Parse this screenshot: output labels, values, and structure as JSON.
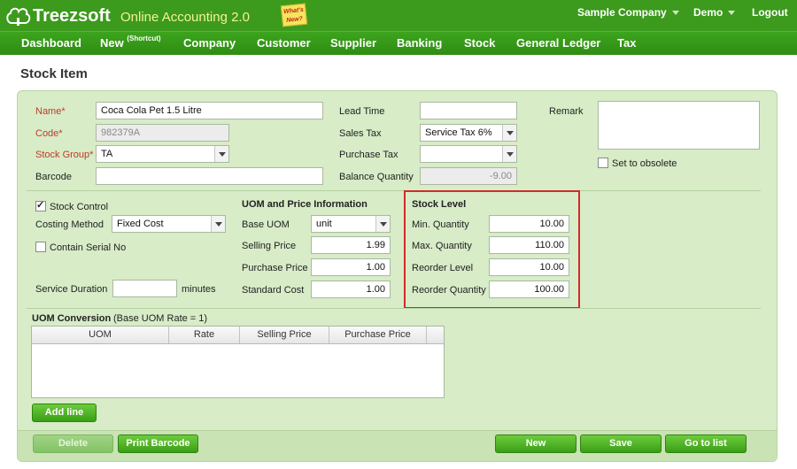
{
  "header": {
    "logo_text": "Treezsoft",
    "logo_sub": "Online Accounting 2.0",
    "whats_new": "What's New?",
    "company": "Sample Company",
    "user": "Demo",
    "logout": "Logout"
  },
  "nav": {
    "dashboard": "Dashboard",
    "new": "New",
    "new_sup": "(Shortcut)",
    "company": "Company",
    "customer": "Customer",
    "supplier": "Supplier",
    "banking": "Banking",
    "stock": "Stock",
    "general_ledger": "General Ledger",
    "tax": "Tax"
  },
  "page": {
    "title": "Stock Item"
  },
  "general": {
    "name_label": "Name*",
    "name_value": "Coca Cola Pet 1.5 Litre",
    "code_label": "Code*",
    "code_value": "982379A",
    "stock_group_label": "Stock Group*",
    "stock_group_value": "TA",
    "barcode_label": "Barcode",
    "barcode_value": "",
    "lead_time_label": "Lead Time",
    "lead_time_value": "",
    "sales_tax_label": "Sales Tax",
    "sales_tax_value": "Service Tax 6%",
    "purchase_tax_label": "Purchase Tax",
    "purchase_tax_value": "",
    "balance_qty_label": "Balance Quantity",
    "balance_qty_value": "-9.00",
    "remark_label": "Remark",
    "remark_value": "",
    "obsolete_label": "Set to obsolete",
    "obsolete_checked": false
  },
  "stock_control": {
    "stock_control_label": "Stock Control",
    "stock_control_checked": true,
    "costing_method_label": "Costing Method",
    "costing_method_value": "Fixed Cost",
    "serial_label": "Contain Serial No",
    "serial_checked": false,
    "service_duration_label": "Service Duration",
    "service_duration_value": "",
    "minutes_label": "minutes"
  },
  "uom_price": {
    "heading": "UOM and Price Information",
    "base_uom_label": "Base UOM",
    "base_uom_value": "unit",
    "selling_price_label": "Selling Price",
    "selling_price_value": "1.99",
    "purchase_price_label": "Purchase Price",
    "purchase_price_value": "1.00",
    "standard_cost_label": "Standard Cost",
    "standard_cost_value": "1.00"
  },
  "stock_level": {
    "heading": "Stock Level",
    "min_label": "Min. Quantity",
    "min_value": "10.00",
    "max_label": "Max. Quantity",
    "max_value": "110.00",
    "reorder_level_label": "Reorder Level",
    "reorder_level_value": "10.00",
    "reorder_qty_label": "Reorder Quantity",
    "reorder_qty_value": "100.00"
  },
  "uom_conversion": {
    "heading": "UOM Conversion",
    "note": "(Base UOM Rate = 1)",
    "columns": [
      "UOM",
      "Rate",
      "Selling Price",
      "Purchase Price"
    ],
    "rows": []
  },
  "buttons": {
    "add_line": "Add line",
    "delete": "Delete",
    "print_barcode": "Print Barcode",
    "new": "New",
    "save": "Save",
    "go_to_list": "Go to list"
  },
  "colors": {
    "brand_green": "#3c9a1c",
    "panel_green": "#d7ecc7",
    "highlight_red": "#d32a2a",
    "required_red": "#c0392b"
  }
}
